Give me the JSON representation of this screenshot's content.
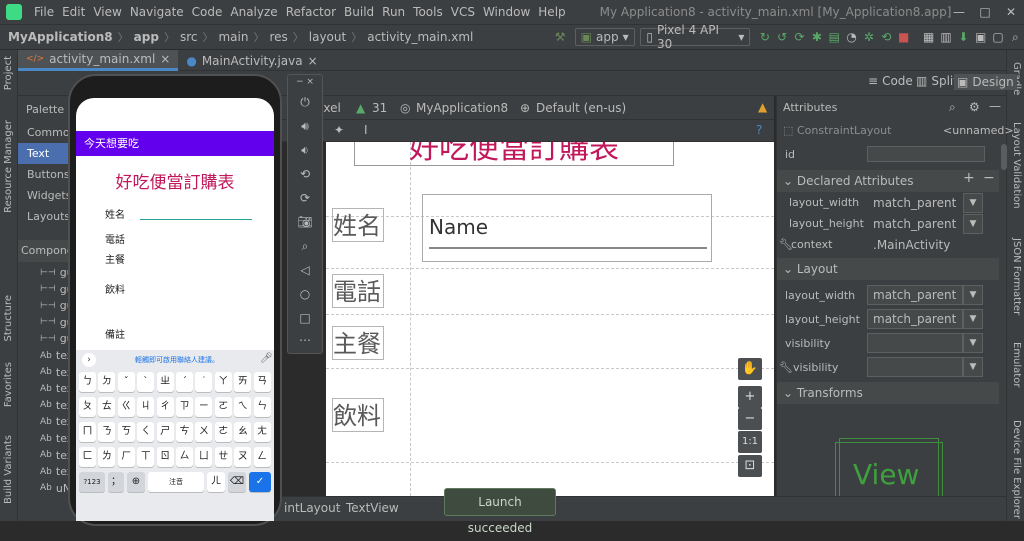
{
  "menubar": {
    "items": [
      "File",
      "Edit",
      "View",
      "Navigate",
      "Code",
      "Analyze",
      "Refactor",
      "Build",
      "Run",
      "Tools",
      "VCS",
      "Window",
      "Help"
    ],
    "window_title": "My Application8 - activity_main.xml [My_Application8.app]"
  },
  "navbar": {
    "crumbs": [
      "MyApplication8",
      "app",
      "src",
      "main",
      "res",
      "layout",
      "activity_main.xml"
    ],
    "run_config": "app",
    "device": "Pixel 4 API 30"
  },
  "tabs": [
    {
      "label": "activity_main.xml"
    },
    {
      "label": "MainActivity.java"
    }
  ],
  "modes": {
    "code": "Code",
    "split": "Split",
    "design": "Design"
  },
  "palette": {
    "title": "Palette",
    "categories": [
      "Common",
      "Text",
      "Buttons",
      "Widgets",
      "Layouts"
    ],
    "selected": "Text",
    "tree_title": "Componen",
    "tree_items": [
      {
        "icon": "⊢⊣",
        "label": "gu"
      },
      {
        "icon": "⊢⊣",
        "label": "gu"
      },
      {
        "icon": "⊢⊣",
        "label": "gu"
      },
      {
        "icon": "⊢⊣",
        "label": "gu"
      },
      {
        "icon": "⊢⊣",
        "label": "gu"
      },
      {
        "icon": "Ab",
        "label": "tex"
      },
      {
        "icon": "Ab",
        "label": "tex"
      },
      {
        "icon": "Ab",
        "label": "tex"
      },
      {
        "icon": "Ab",
        "label": "tex"
      },
      {
        "icon": "Ab",
        "label": "tex"
      },
      {
        "icon": "Ab",
        "label": "tex"
      },
      {
        "icon": "Ab",
        "label": "tex"
      },
      {
        "icon": "Ab",
        "label": "tex"
      },
      {
        "icon": "Ab",
        "label": "uN"
      }
    ]
  },
  "canvas_toolbar": {
    "device": "ixel",
    "api": "31",
    "theme": "MyApplication8",
    "locale": "Default (en-us)"
  },
  "blueprint": {
    "title": "好吃便當訂購表",
    "labels": [
      "姓名",
      "電話",
      "主餐",
      "飲料"
    ],
    "name_hint": "Name"
  },
  "attributes": {
    "title": "Attributes",
    "class": "ConstraintLayout",
    "class_value": "<unnamed>",
    "id_label": "id",
    "declared_section": "Declared Attributes",
    "declared": [
      {
        "name": "layout_width",
        "value": "match_parent"
      },
      {
        "name": "layout_height",
        "value": "match_parent"
      },
      {
        "name": "context",
        "value": ".MainActivity"
      }
    ],
    "layout_section": "Layout",
    "layout": [
      {
        "name": "layout_width",
        "value": "match_parent"
      },
      {
        "name": "layout_height",
        "value": "match_parent"
      },
      {
        "name": "visibility",
        "value": ""
      },
      {
        "name": "visibility",
        "value": ""
      }
    ],
    "transforms_section": "Transforms",
    "preview_text": "View"
  },
  "left_tools": [
    "Project",
    "Resource Manager",
    "Structure",
    "Favorites",
    "Build Variants"
  ],
  "right_tools": [
    "Gradle",
    "Layout Validation",
    "JSON Formatter",
    "Emulator",
    "Device File Explorer"
  ],
  "status": {
    "breadcrumb": [
      "intLayout",
      "TextView"
    ],
    "toast": "Launch succeeded"
  },
  "emulator": {
    "app_title": "今天想要吃",
    "form_title": "好吃便當訂購表",
    "labels": [
      "姓名",
      "電話",
      "主餐",
      "飲料",
      "備註"
    ],
    "suggestion": "輕觸即可啟用聯絡人建議。",
    "keys": [
      [
        "ㄅ",
        "ㄉ",
        "ˇ",
        "ˋ",
        "ㄓ",
        "ˊ",
        "˙",
        "ㄚ",
        "ㄞ",
        "ㄢ"
      ],
      [
        "ㄆ",
        "ㄊ",
        "ㄍ",
        "ㄐ",
        "ㄔ",
        "ㄗ",
        "ㄧ",
        "ㄛ",
        "ㄟ",
        "ㄣ"
      ],
      [
        "ㄇ",
        "ㄋ",
        "ㄎ",
        "ㄑ",
        "ㄕ",
        "ㄘ",
        "ㄨ",
        "ㄜ",
        "ㄠ",
        "ㄤ"
      ],
      [
        "ㄈ",
        "ㄌ",
        "ㄏ",
        "ㄒ",
        "ㄖ",
        "ㄙ",
        "ㄩ",
        "ㄝ",
        "ㄡ",
        "ㄥ"
      ]
    ],
    "key_sym": "?123",
    "key_punct": "；",
    "key_space": "注音",
    "key_er": "ㄦ"
  },
  "colors": {
    "accent": "#6200ee",
    "title_red": "#c2185b",
    "selection": "#4b6eaf",
    "ide_bg": "#3c3f41"
  }
}
